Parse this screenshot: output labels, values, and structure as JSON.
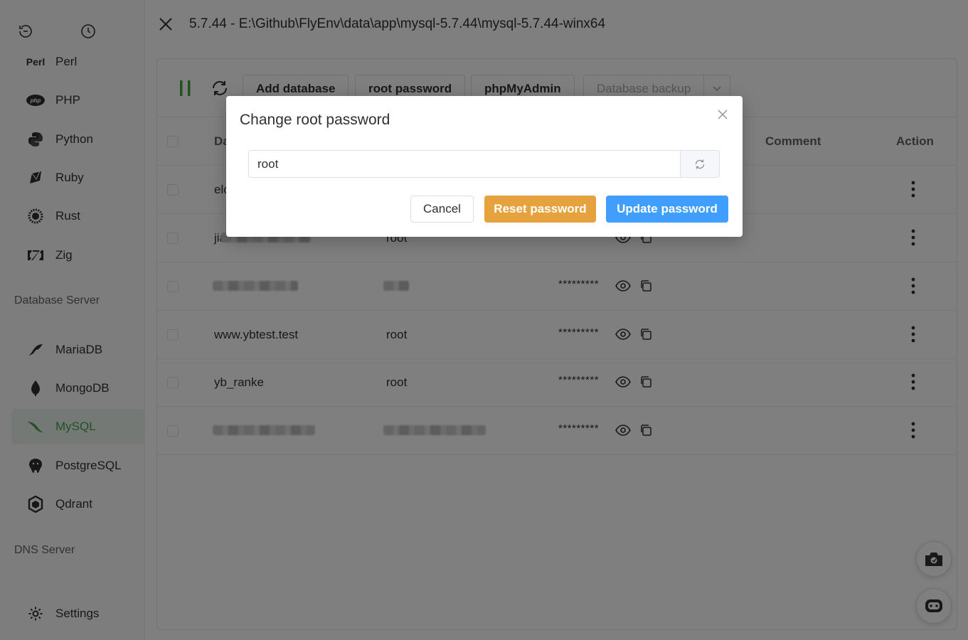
{
  "sidebar": {
    "items_top": [
      {
        "label": "Perl",
        "icon": "perl-icon",
        "icon_text": "Perl"
      },
      {
        "label": "PHP",
        "icon": "php-icon",
        "icon_text": "php"
      },
      {
        "label": "Python",
        "icon": "python-icon"
      },
      {
        "label": "Ruby",
        "icon": "ruby-icon"
      },
      {
        "label": "Rust",
        "icon": "rust-icon"
      },
      {
        "label": "Zig",
        "icon": "zig-icon"
      }
    ],
    "section_db": "Database Server",
    "items_db": [
      {
        "label": "MariaDB",
        "icon": "mariadb-icon"
      },
      {
        "label": "MongoDB",
        "icon": "mongodb-icon"
      },
      {
        "label": "MySQL",
        "icon": "mysql-icon",
        "active": true
      },
      {
        "label": "PostgreSQL",
        "icon": "postgresql-icon"
      },
      {
        "label": "Qdrant",
        "icon": "qdrant-icon"
      }
    ],
    "section_dns": "DNS Server",
    "settings": "Settings"
  },
  "header": {
    "title": "5.7.44 - E:\\Github\\FlyEnv\\data\\app\\mysql-5.7.44\\mysql-5.7.44-winx64"
  },
  "toolbar": {
    "add_database": "Add database",
    "root_password": "root password",
    "phpmyadmin": "phpMyAdmin",
    "database_backup": "Database backup"
  },
  "table": {
    "columns": [
      "Da",
      "Comment",
      "Action"
    ],
    "password_mask": "*********",
    "rows": [
      {
        "name": "elc",
        "user": "",
        "has_password": false
      },
      {
        "name": "jia",
        "user": "root",
        "has_password": true
      },
      {
        "name": "",
        "user": "",
        "has_password": true,
        "blurred": true
      },
      {
        "name": "www.ybtest.test",
        "user": "root",
        "has_password": true
      },
      {
        "name": "yb_ranke",
        "user": "root",
        "has_password": true
      },
      {
        "name": "",
        "user": "",
        "has_password": true,
        "blurred": true
      }
    ]
  },
  "dialog": {
    "title": "Change root password",
    "password_value": "root",
    "cancel": "Cancel",
    "reset": "Reset password",
    "update": "Update password"
  },
  "colors": {
    "accent": "#409eff",
    "warning": "#e6a23c",
    "mysql_active": "#47a349"
  }
}
